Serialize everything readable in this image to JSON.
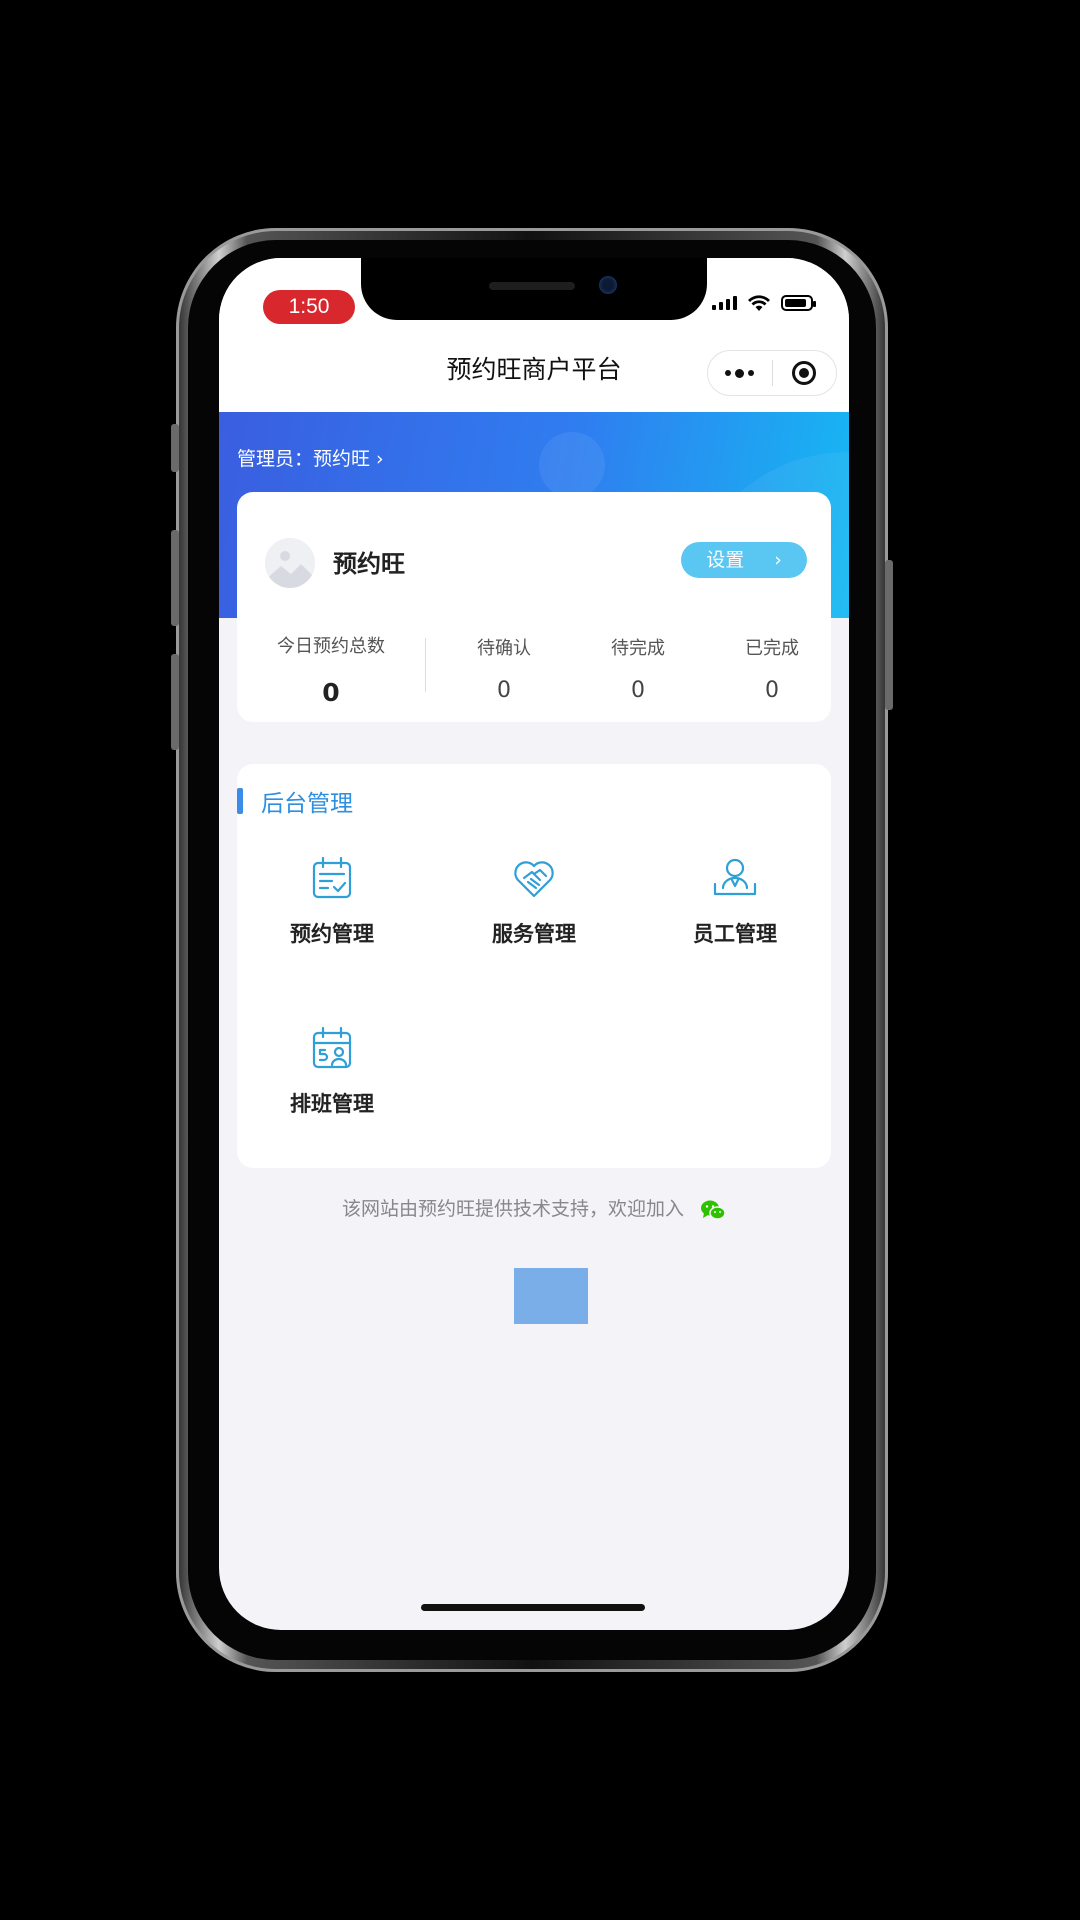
{
  "status_bar": {
    "time": "1:50"
  },
  "nav": {
    "title": "预约旺商户平台"
  },
  "header": {
    "admin_link": "管理员：预约旺 ›"
  },
  "store": {
    "name": "预约旺",
    "settings_label": "设置"
  },
  "stats": [
    {
      "label": "今日预约总数",
      "value": "0"
    },
    {
      "label": "待确认",
      "value": "0"
    },
    {
      "label": "待完成",
      "value": "0"
    },
    {
      "label": "已完成",
      "value": "0"
    }
  ],
  "management": {
    "title": "后台管理",
    "items": [
      {
        "label": "预约管理",
        "icon": "appointment-calendar-icon"
      },
      {
        "label": "服务管理",
        "icon": "heart-handshake-icon"
      },
      {
        "label": "员工管理",
        "icon": "staff-person-icon"
      },
      {
        "label": "排班管理",
        "icon": "schedule-calendar-icon"
      }
    ]
  },
  "footer": {
    "note": "该网站由预约旺提供技术支持，欢迎加入"
  },
  "colors": {
    "accent": "#2c8fe0",
    "banner_start": "#3a5ee0",
    "banner_end": "#16b9f2",
    "time_pill": "#d9272e",
    "wechat": "#2dc100"
  }
}
